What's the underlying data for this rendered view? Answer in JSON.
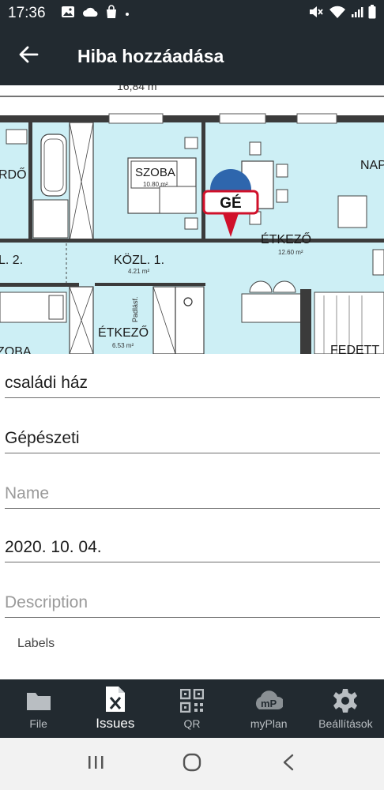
{
  "status_bar": {
    "time": "17:36"
  },
  "app_bar": {
    "title": "Hiba hozzáadása"
  },
  "plan": {
    "room_labels": [
      "SZOBA",
      "10.80 m²",
      "ÉTKEZŐ",
      "12.60 m²",
      "KÖZL. 1.",
      "4.21 m²",
      "ÉTKEZŐ",
      "6.53 m²",
      "RDŐ",
      "L. 2.",
      "ZOBA",
      "NAP",
      "FEDETT",
      "Padlásf.",
      "16,84 m"
    ],
    "marker_label": "GÉ"
  },
  "form": {
    "project_value": "családi ház",
    "category_value": "Gépészeti",
    "name_placeholder": "Name",
    "date_value": "2020. 10. 04.",
    "description_placeholder": "Description",
    "labels_text": "Labels"
  },
  "bottom_nav": {
    "items": [
      {
        "label": "File",
        "icon": "folder-icon"
      },
      {
        "label": "Issues",
        "icon": "excel-file-icon"
      },
      {
        "label": "QR",
        "icon": "qr-code-icon"
      },
      {
        "label": "myPlan",
        "icon": "myplan-logo-icon"
      },
      {
        "label": "Beállítások",
        "icon": "gear-icon"
      }
    ],
    "active_index": 1
  },
  "colors": {
    "bar_background": "#222a30",
    "plan_room_fill": "#cdeff5",
    "marker_red": "#d0102a",
    "marker_circle": "#2e66ad"
  }
}
